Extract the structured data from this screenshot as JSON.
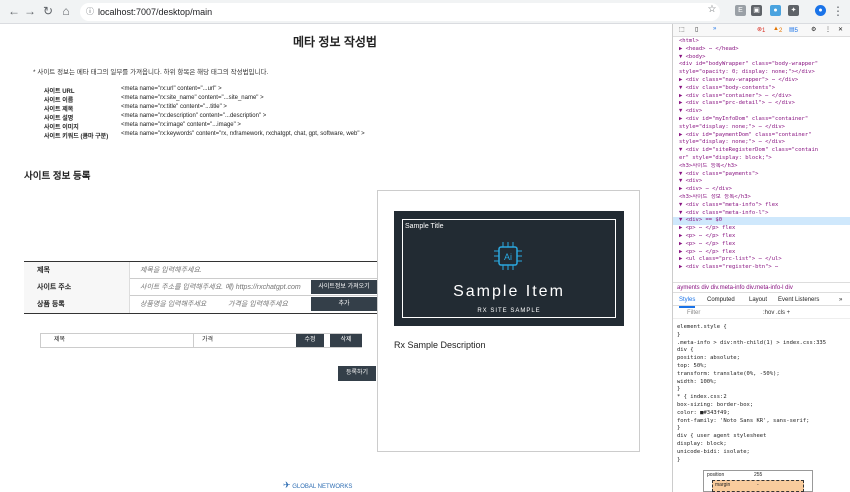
{
  "browser": {
    "url": "localhost:7007/desktop/main"
  },
  "page": {
    "title": "메타 정보 작성법",
    "note": "* 사이트 정보는 메타 태그의 일부를 가져옵니다. 하위 항목은 해당 태그의 작성법입니다.",
    "meta_rows": [
      {
        "key": "사이트 URL",
        "value": "<meta name=\"rx:url\" content=\"...url\" >"
      },
      {
        "key": "사이트 이름",
        "value": "<meta name=\"rx:site_name\" content=\"...site_name\" >"
      },
      {
        "key": "사이트 제목",
        "value": "<meta name=\"rx:title\" content=\"...title\" >"
      },
      {
        "key": "사이트 설명",
        "value": "<meta name=\"rx:description\" content=\"...description\" >"
      },
      {
        "key": "사이트 이미지",
        "value": "<meta name=\"rx:image\" content=\"...image\" >"
      },
      {
        "key": "사이트 키워드 (콤마 구분)",
        "value": "<meta name=\"rx:keywords\" content=\"rx, rxframework, rxchatgpt, chat, gpt, software, web\" >"
      }
    ],
    "register_heading": "사이트 정보 등록",
    "form": {
      "title_label": "제목",
      "title_placeholder": "제목을 입력해주세요.",
      "url_label": "사이트 주소",
      "url_placeholder": "사이트 주소를 입력해주세요. 예) https://rxchatgpt.com",
      "fetch_button": "사이트정보 가져오기",
      "product_label": "상품 등록",
      "product_name_placeholder": "상품명을 입력해주세요",
      "price_placeholder": "가격을 입력해주세요",
      "add_button": "추가"
    },
    "product_list": {
      "name_col": "제목",
      "price_col": "가격",
      "edit_button": "수정",
      "delete_button": "삭제"
    },
    "submit_button": "등록하기",
    "preview": {
      "sample_title": "Sample Title",
      "logo_text": "Ai",
      "big_text": "Sample Item",
      "sub_text": "RX SITE SAMPLE",
      "description": "Rx Sample Description"
    },
    "footer_text": "GLOBAL NETWORKS"
  },
  "devtools": {
    "errors": "1",
    "warnings": "2",
    "messages": "5",
    "dom_lines": [
      "<html>",
      "▶ <head> ⋯ </head>",
      "▼ <body>",
      "  <div id=\"bodyWrapper\" class=\"body-wrapper\"",
      "  style=\"opacity: 0; display: none;\"></div>",
      "  ▶ <div class=\"nav-wrapper\"> ⋯ </div>",
      "  ▼ <div class=\"body-contents\">",
      "    ▶ <div class=\"container\"> ⋯ </div>",
      "    ▶ <div class=\"prc-detail\"> ⋯ </div>",
      "    ▼ <div>",
      "      ▶ <div id=\"myInfoDom\" class=\"container\"",
      "      style=\"display: none;\"> ⋯ </div>",
      "      ▶ <div id=\"paymentDom\" class=\"container\"",
      "      style=\"display: none;\"> ⋯ </div>",
      "      ▼ <div id=\"siteRegisterDom\" class=\"contain",
      "      er\" style=\"display: block;\">",
      "        <h3>사이트 등록</h3>",
      "        ▼ <div class=\"payments\">",
      "          ▼ <div>",
      "            ▶ <div> ⋯ </div>",
      "            <h3>사이트 정보 등록</h3>",
      "            ▼ <div class=\"meta-info\"> flex",
      "              ▼ <div class=\"meta-info-l\">",
      "                ▼ <div> == $0",
      "                  ▶ <p> ⋯ </p> flex",
      "                  ▶ <p> ⋯ </p> flex",
      "                  ▶ <p> ⋯ </p> flex",
      "                  ▶ <p> ⋯ </p> flex",
      "                ▶ <ul class=\"prc-list\"> ⋯ </ul>",
      "                ▶ <div class=\"register-btn\"> ⋯"
    ],
    "breadcrumbs": "ayments  div  div.meta-info  div.meta-info-l  div",
    "tabs": [
      "Styles",
      "Computed",
      "Layout",
      "Event Listeners",
      "»"
    ],
    "filter_placeholder": "Filter",
    "filter_tools": ":hov  .cls  +",
    "css_lines": [
      "element.style {",
      "}",
      ".meta-info > div:nth-child(1) >        index.css:335",
      "div {",
      "  position: absolute;",
      "  top: 50%;",
      "  transform: translate(0%, -50%);",
      "  width: 100%;",
      "}",
      "* {                                      index.css:2",
      "  box-sizing: border-box;",
      "  color: ■#343f49;",
      "  font-family: 'Noto Sans KR', sans-serif;",
      "}",
      "div {                        user agent stylesheet",
      "  display: block;",
      "  unicode-bidi: isolate;",
      "}"
    ],
    "box_model": {
      "position_label": "position",
      "position_value": "255",
      "margin_label": "margin",
      "margin_value": "-"
    }
  }
}
